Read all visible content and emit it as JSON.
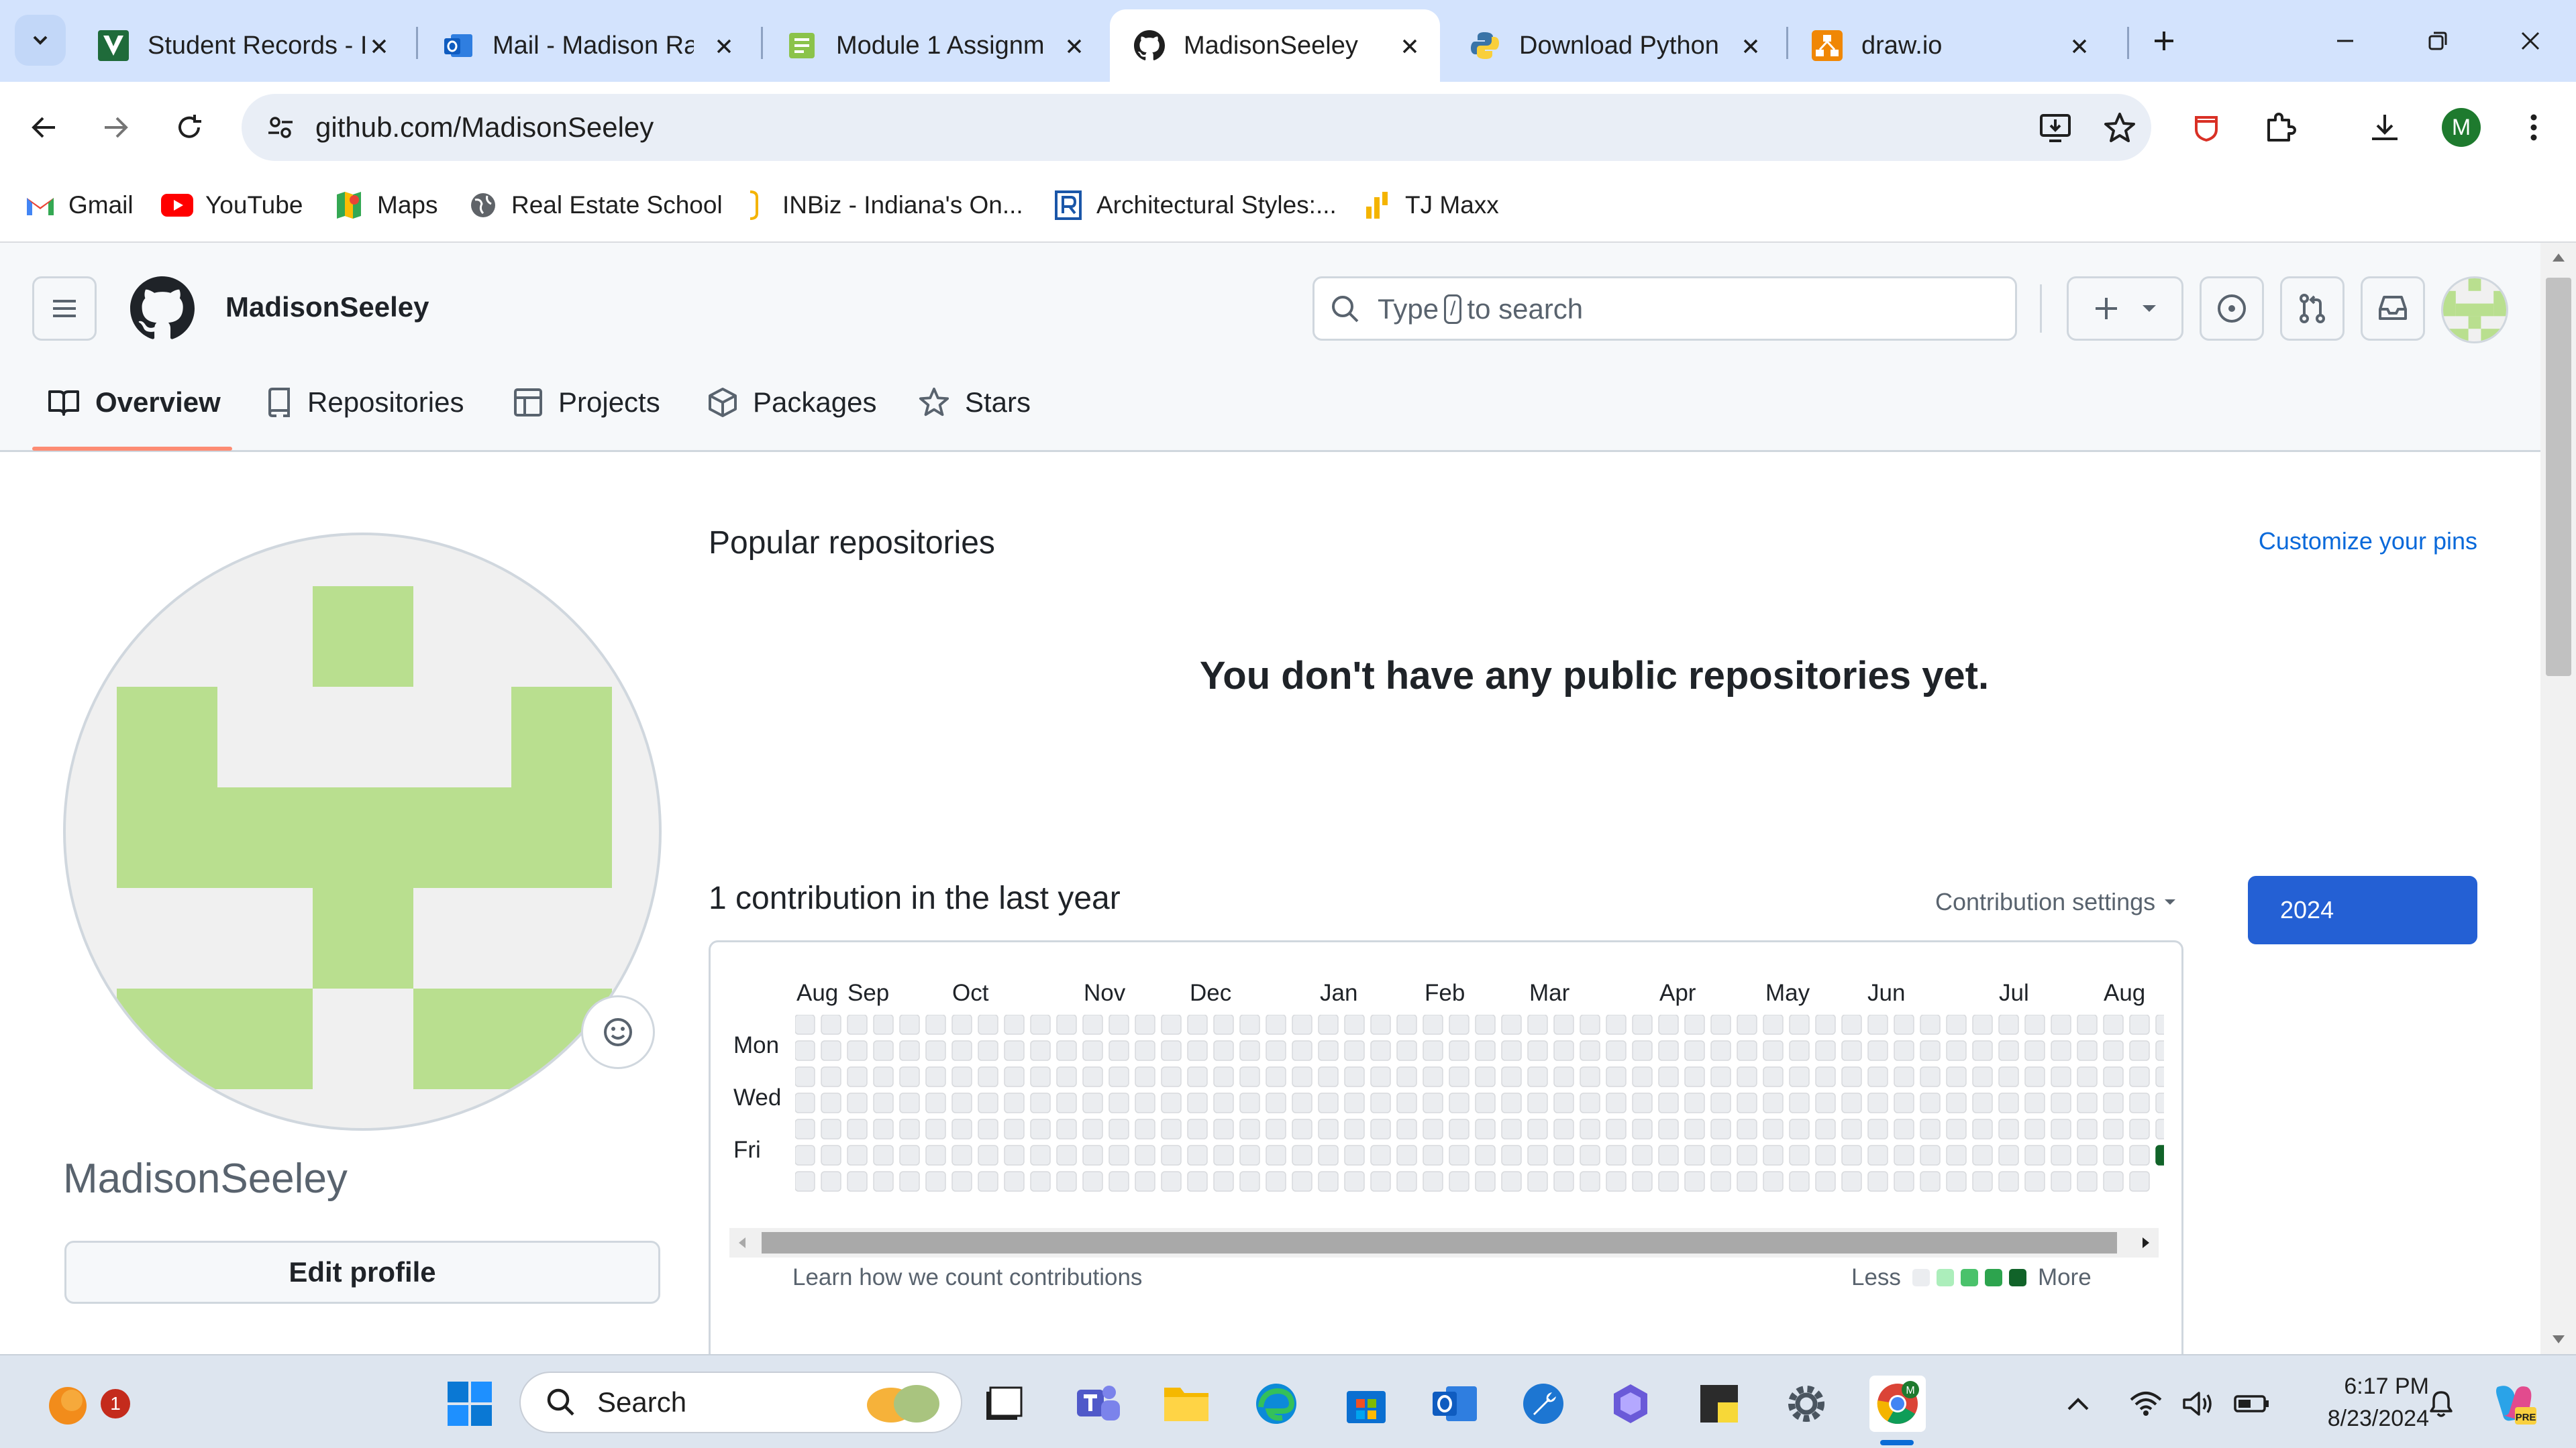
{
  "browser": {
    "tabs": [
      {
        "title": "Student Records - I",
        "icon": "ivy-tech-icon"
      },
      {
        "title": "Mail - Madison Ra",
        "icon": "outlook-icon"
      },
      {
        "title": "Module 1 Assignm",
        "icon": "assignment-icon"
      },
      {
        "title": "MadisonSeeley",
        "icon": "github-icon",
        "active": true
      },
      {
        "title": "Download Python",
        "icon": "python-icon"
      },
      {
        "title": "draw.io",
        "icon": "drawio-icon"
      }
    ],
    "url": "github.com/MadisonSeeley",
    "profile_initial": "M",
    "bookmarks": [
      {
        "label": "Gmail",
        "icon": "gmail-icon"
      },
      {
        "label": "YouTube",
        "icon": "youtube-icon"
      },
      {
        "label": "Maps",
        "icon": "maps-icon"
      },
      {
        "label": "Real Estate School",
        "icon": "globe-icon"
      },
      {
        "label": "INBiz - Indiana's On...",
        "icon": "bookmark-icon"
      },
      {
        "label": "Architectural Styles:...",
        "icon": "bookmark-icon"
      },
      {
        "label": "TJ Maxx",
        "icon": "tjmaxx-icon"
      }
    ]
  },
  "github": {
    "username": "MadisonSeeley",
    "search_prefix": "Type",
    "search_key": "/",
    "search_suffix": "to search",
    "nav": [
      {
        "label": "Overview",
        "icon": "book-icon",
        "active": true
      },
      {
        "label": "Repositories",
        "icon": "repo-icon"
      },
      {
        "label": "Projects",
        "icon": "table-icon"
      },
      {
        "label": "Packages",
        "icon": "package-icon"
      },
      {
        "label": "Stars",
        "icon": "star-icon"
      }
    ],
    "profile": {
      "display_name": "MadisonSeeley",
      "edit_button": "Edit profile"
    },
    "popular": {
      "heading": "Popular repositories",
      "customize_link": "Customize your pins",
      "empty_message": "You don't have any public repositories yet."
    },
    "contributions": {
      "heading": "1 contribution in the last year",
      "settings_label": "Contribution settings",
      "year": "2024",
      "months": [
        "Aug",
        "Sep",
        "Oct",
        "Nov",
        "Dec",
        "Jan",
        "Feb",
        "Mar",
        "Apr",
        "May",
        "Jun",
        "Jul",
        "Aug"
      ],
      "days": [
        "Mon",
        "Wed",
        "Fri"
      ],
      "learn_link": "Learn how we count contributions",
      "legend_less": "Less",
      "legend_more": "More",
      "level_colors": [
        "#ebedf0",
        "#aceebb",
        "#4ac26b",
        "#2da44e",
        "#116329"
      ],
      "total": 1
    }
  },
  "taskbar": {
    "search_label": "Search",
    "notification_count": "1",
    "time": "6:17 PM",
    "date": "8/23/2024"
  }
}
